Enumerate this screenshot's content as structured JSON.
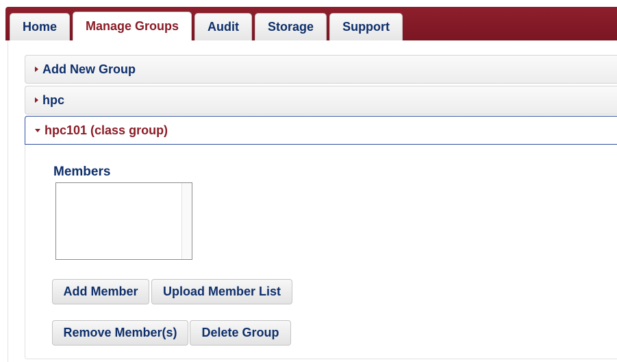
{
  "tabs": [
    {
      "label": "Home",
      "active": false
    },
    {
      "label": "Manage Groups",
      "active": true
    },
    {
      "label": "Audit",
      "active": false
    },
    {
      "label": "Storage",
      "active": false
    },
    {
      "label": "Support",
      "active": false
    }
  ],
  "groups": [
    {
      "label": "Add New Group",
      "expanded": false
    },
    {
      "label": "hpc",
      "expanded": false
    },
    {
      "label": "hpc101 (class group)",
      "expanded": true
    }
  ],
  "group_detail": {
    "members_label": "Members",
    "members": [],
    "buttons": {
      "add_member": "Add Member",
      "upload_member_list": "Upload Member List",
      "remove_members": "Remove Member(s)",
      "delete_group": "Delete Group"
    }
  },
  "colors": {
    "tab_bar": "#7a1622",
    "nav_text": "#0e2f6b",
    "active_text": "#8a1c26",
    "open_border": "#2c4f9e"
  }
}
